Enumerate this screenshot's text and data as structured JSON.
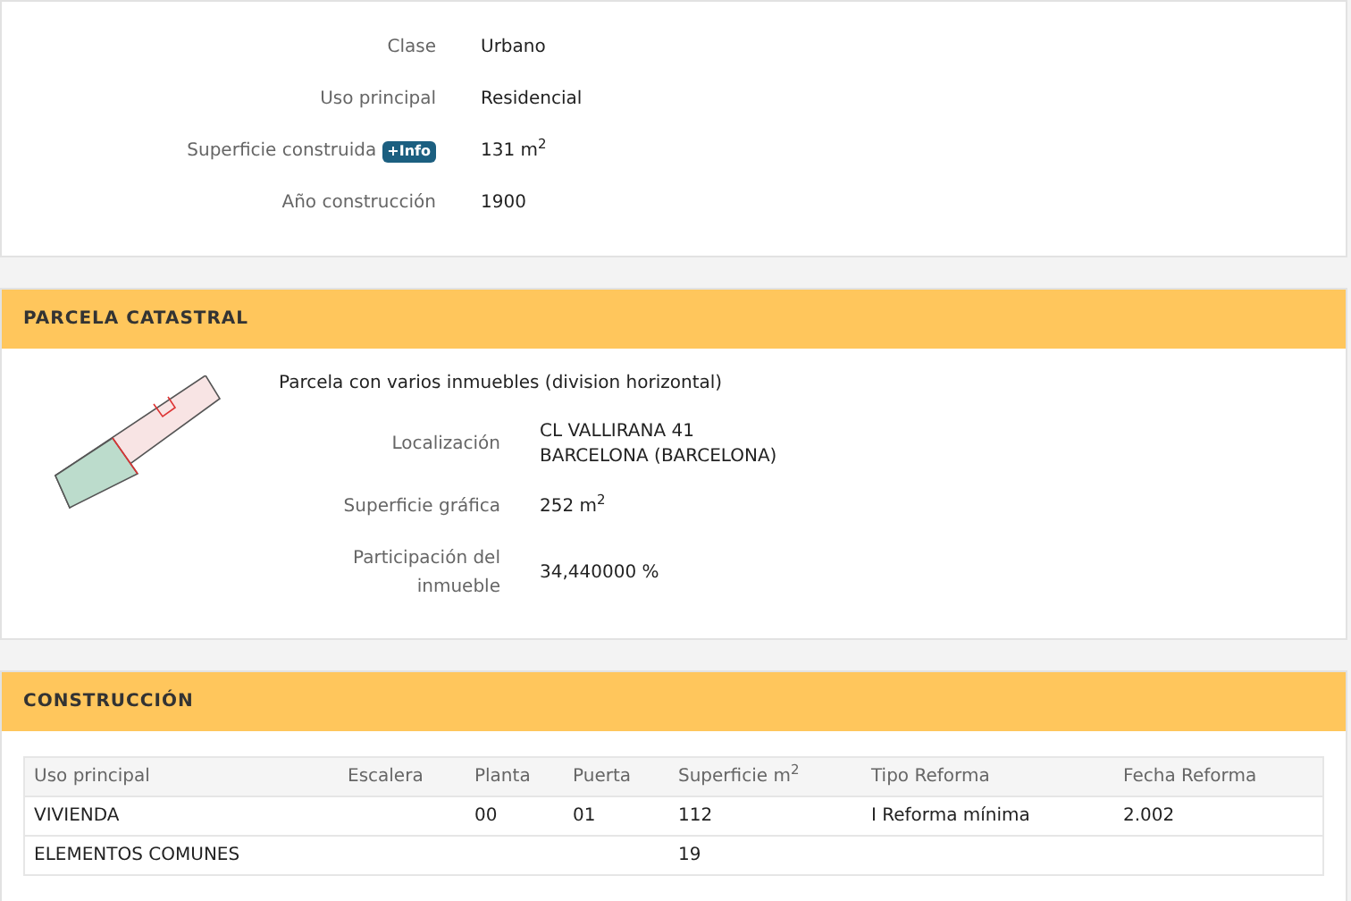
{
  "inmueble": {
    "fields": [
      {
        "label": "Clase",
        "value": "Urbano"
      },
      {
        "label": "Uso principal",
        "value": "Residencial"
      },
      {
        "label": "Superficie construida",
        "badge": "+Info",
        "value": "131 m$^{2}$"
      },
      {
        "label": "Año construcción",
        "value": "1900"
      }
    ]
  },
  "parcela": {
    "title": "PARCELA CATASTRAL",
    "description": "Parcela con varios inmuebles (division horizontal)",
    "fields": [
      {
        "label": "Localización",
        "lines": [
          "CL VALLIRANA 41",
          "BARCELONA (BARCELONA)"
        ]
      },
      {
        "label": "Superficie gráfica",
        "value": "252 m$^{2}$"
      },
      {
        "label": "Participación del inmueble",
        "value": "34,440000 %"
      }
    ]
  },
  "construccion": {
    "title": "CONSTRUCCIÓN",
    "table": {
      "columns": [
        "Uso principal",
        "Escalera",
        "Planta",
        "Puerta",
        "Superficie m$^{2}$",
        "Tipo Reforma",
        "Fecha Reforma"
      ],
      "rows": [
        [
          "VIVIENDA",
          "",
          "00",
          "01",
          "112",
          "I Reforma mínima",
          "2.002"
        ],
        [
          "ELEMENTOS COMUNES",
          "",
          "",
          "",
          "19",
          "",
          ""
        ]
      ]
    }
  }
}
